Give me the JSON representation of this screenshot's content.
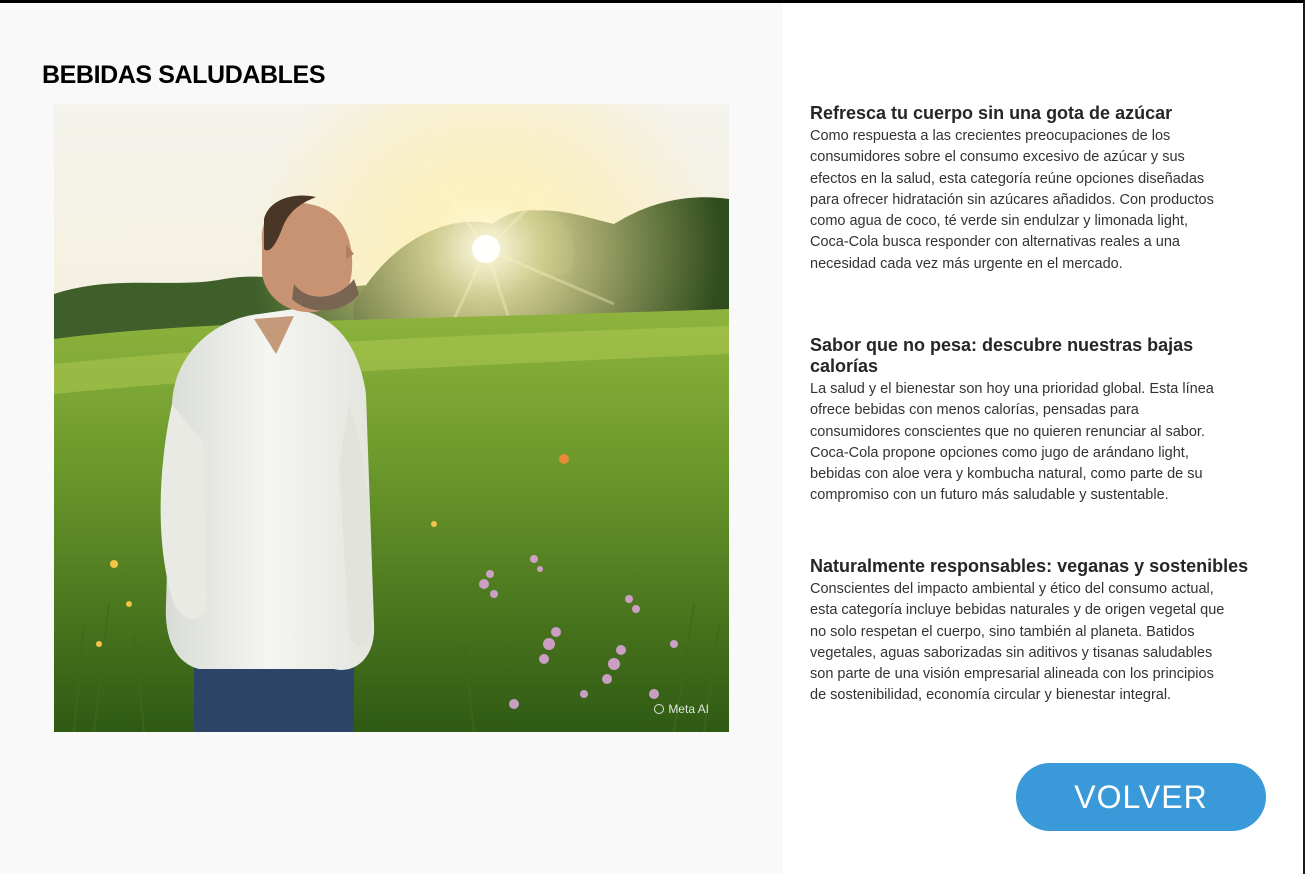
{
  "page": {
    "title": "BEBIDAS SALUDABLES"
  },
  "hero_image": {
    "description_icon": "photo-man-in-meadow",
    "watermark": "Meta AI"
  },
  "sections": [
    {
      "heading": "Refresca tu cuerpo sin una gota de azúcar",
      "body": "Como respuesta a las crecientes preocupaciones de los\nconsumidores    sobre el consumo excesivo de azúcar y sus\nefectos en la salud, esta categoría reúne opciones diseñadas\npara ofrecer hidratación sin azúcares añadidos. Con productos\ncomo agua de coco, té verde sin endulzar y limonada light,\nCoca-Cola busca responder con alternativas reales a una\nnecesidad cada vez más urgente en el mercado."
    },
    {
      "heading": "Sabor que no pesa: descubre nuestras bajas calorías",
      "body": "La salud y el bienestar son hoy una prioridad global. Esta línea\nofrece bebidas con menos calorías, pensadas para\nconsumidores conscientes que no quieren renunciar al sabor.\nCoca-Cola propone opciones como jugo de arándano light,\nbebidas con aloe vera y kombucha natural, como parte de su\ncompromiso con un futuro más saludable y sustentable."
    },
    {
      "heading": "Naturalmente responsables: veganas y sostenibles",
      "body": "Conscientes del impacto ambiental y ético del consumo actual,\nesta categoría incluye bebidas naturales y de origen vegetal que\nno solo respetan el cuerpo, sino también al planeta. Batidos\nvegetales, aguas saborizadas sin aditivos y tisanas saludables\nson parte de una visión empresarial alineada con los principios\nde sostenibilidad, economía circular y bienestar integral."
    }
  ],
  "actions": {
    "back_label": "VOLVER"
  },
  "colors": {
    "button": "#3a9ad9",
    "left_panel": "#f9f9f9",
    "heading_text": "#262626",
    "body_text": "#333333"
  }
}
